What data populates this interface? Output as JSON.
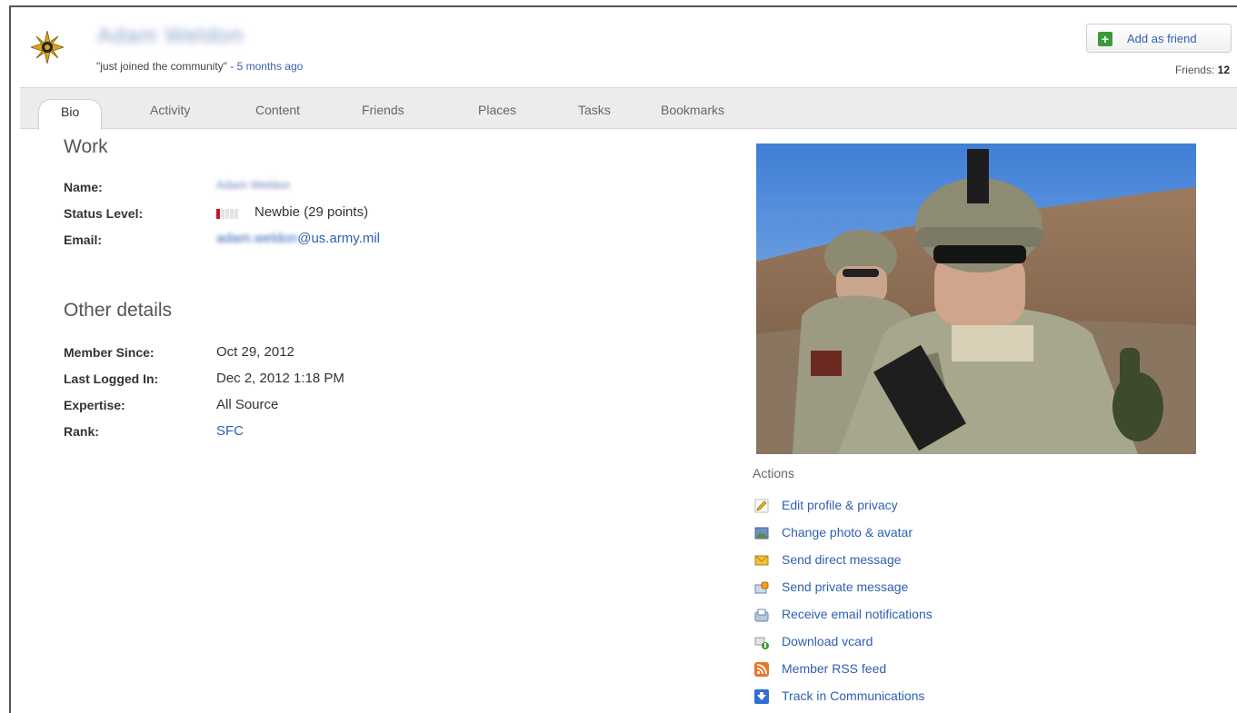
{
  "header": {
    "user_name": "Adam Weldon",
    "status_text": "\"just joined the community\" - ",
    "status_ago": "5 months ago",
    "add_friend_label": "Add as friend",
    "friends_label": "Friends: ",
    "friends_count": "12"
  },
  "tabs": [
    "Bio",
    "Activity",
    "Content",
    "Friends",
    "Places",
    "Tasks",
    "Bookmarks"
  ],
  "active_tab": "Bio",
  "work": {
    "title": "Work",
    "name_label": "Name:",
    "name_value": "Adam Weldon",
    "status_label": "Status Level:",
    "status_value": "Newbie (29 points)",
    "status_level_filled": 1,
    "status_level_total": 5,
    "email_label": "Email:",
    "email_local": "adam.weldon",
    "email_domain": "@us.army.mil"
  },
  "other": {
    "title": "Other details",
    "member_since_label": "Member Since:",
    "member_since_value": "Oct 29, 2012",
    "last_logged_label": "Last Logged In:",
    "last_logged_value": "Dec 2, 2012 1:18 PM",
    "expertise_label": "Expertise:",
    "expertise_value": "All Source",
    "rank_label": "Rank:",
    "rank_value": "SFC"
  },
  "actions": {
    "title": "Actions",
    "items": [
      {
        "label": "Edit profile & privacy",
        "icon": "pencil-icon"
      },
      {
        "label": "Change photo & avatar",
        "icon": "picture-icon"
      },
      {
        "label": "Send direct message",
        "icon": "envelope-icon"
      },
      {
        "label": "Send private message",
        "icon": "lock-envelope-icon"
      },
      {
        "label": "Receive email notifications",
        "icon": "mailbox-icon"
      },
      {
        "label": "Download vcard",
        "icon": "vcard-icon"
      },
      {
        "label": "Member RSS feed",
        "icon": "rss-icon"
      },
      {
        "label": "Track in Communications",
        "icon": "track-icon"
      }
    ]
  },
  "colors": {
    "link": "#2f5fb2",
    "tab_bar": "#ececec",
    "status_red": "#c4142c",
    "add_green": "#3a9a3a"
  }
}
